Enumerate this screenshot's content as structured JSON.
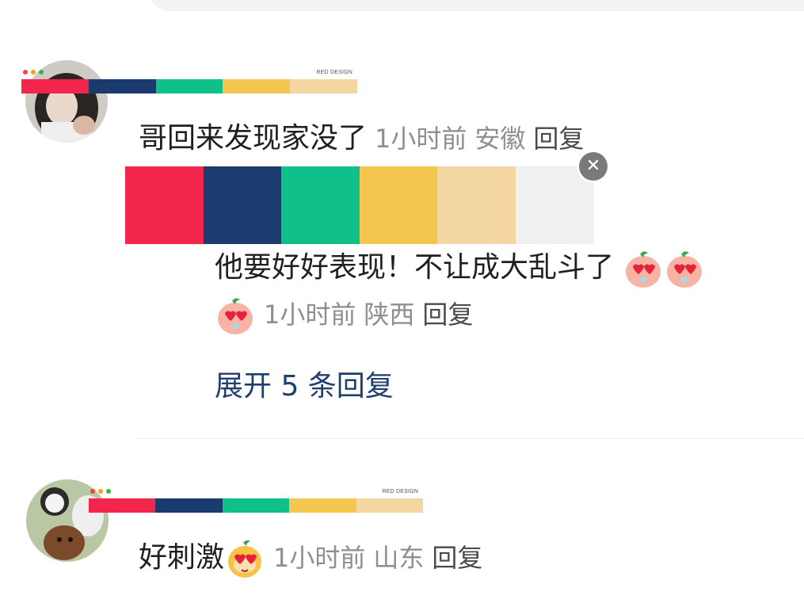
{
  "palette": {
    "brand": "RED DESIGN",
    "dots": [
      "#e34b3c",
      "#f0a020",
      "#3cb44a"
    ],
    "colors": [
      "#f2264d",
      "#1b3a6e",
      "#10c08a",
      "#f3c64f",
      "#f3d6a1",
      "#f0f0f0"
    ]
  },
  "comments": [
    {
      "text": "哥回来发现家没了",
      "time": "1小时前",
      "location": "安徽",
      "reply": "回复"
    },
    {
      "text": "他要好好表现！不让成大乱斗了",
      "time": "1小时前",
      "location": "陕西",
      "reply": "回复",
      "emoji": "heart-eyes-peach-emoji"
    },
    {
      "text": "好刺激",
      "time": "1小时前",
      "location": "山东",
      "reply": "回复",
      "emoji": "heart-eyes-pear-emoji"
    }
  ],
  "expand": {
    "label": "展开 5 条回复"
  },
  "close_symbol": "✕"
}
